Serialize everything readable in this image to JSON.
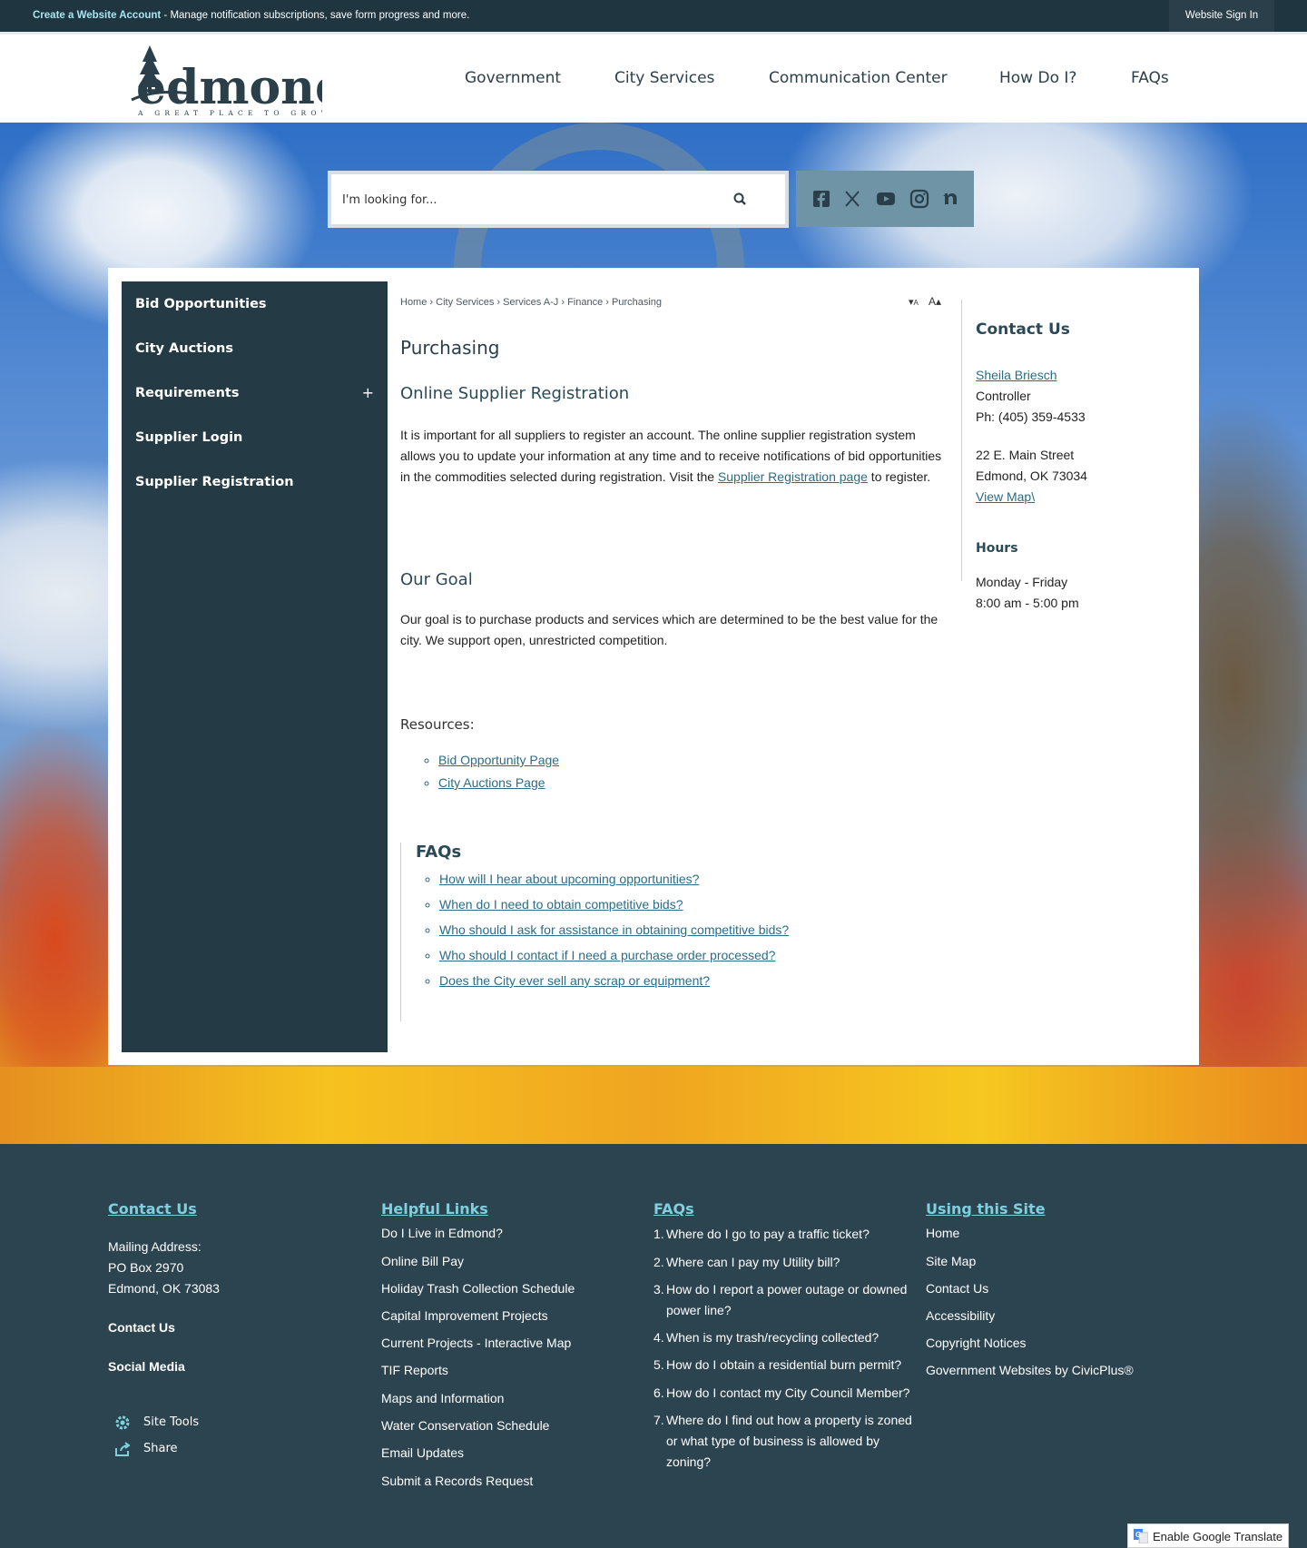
{
  "topbar": {
    "create_account_link": "Create a Website Account",
    "create_account_desc": " - Manage notification subscriptions, save form progress and more.",
    "sign_in": "Website Sign In"
  },
  "header": {
    "logo_text": "edmond",
    "logo_tagline": "A GREAT PLACE TO GROW",
    "nav": [
      "Government",
      "City Services",
      "Communication Center",
      "How Do I?",
      "FAQs"
    ]
  },
  "search": {
    "placeholder": "I'm looking for..."
  },
  "social": [
    "facebook-icon",
    "x-icon",
    "youtube-icon",
    "instagram-icon",
    "nextdoor-icon"
  ],
  "sidenav": {
    "items": [
      "Bid Opportunities",
      "City Auctions",
      "Requirements",
      "Supplier Login",
      "Supplier Registration"
    ],
    "expand_symbol": "+"
  },
  "breadcrumb": {
    "items": [
      "Home",
      "City Services",
      "Services A-J",
      "Finance",
      "Purchasing"
    ],
    "separator": "›"
  },
  "font_size": {
    "decrease": "A",
    "increase": "A"
  },
  "page": {
    "title": "Purchasing",
    "section1_title": "Online Supplier Registration",
    "section1_text_a": "It is important for all suppliers to register an account. The online supplier registration system allows you to update your information at any time and to receive notifications of bid opportunities in the commodities selected during registration. Visit the ",
    "section1_link": "Supplier Registration page",
    "section1_text_b": " to register.",
    "section2_title": "Our Goal",
    "section2_text": "Our goal is to purchase products and services which are determined to be the best value for the city. We support open, unrestricted competition.",
    "resources_label": "Resources:",
    "resources": [
      "Bid Opportunity Page",
      "City Auctions Page"
    ],
    "faqs_title": "FAQs",
    "faqs": [
      "How will I hear about upcoming opportunities?",
      "When do I need to obtain competitive bids?",
      "Who should I ask for assistance in obtaining competitive bids?",
      "Who should I contact if I need a purchase order processed?",
      "Does the City ever sell any scrap or equipment?"
    ]
  },
  "contact": {
    "title": "Contact Us",
    "name": "Sheila Briesch",
    "role": "Controller",
    "phone": "Ph: (405) 359-4533",
    "address1": "22 E. Main Street",
    "address2": "Edmond, OK 73034",
    "map_link": "View Map\\",
    "hours_title": "Hours",
    "hours_days": "Monday - Friday",
    "hours_time": "8:00 am - 5:00 pm"
  },
  "footer": {
    "contact": {
      "heading": "Contact Us",
      "mail_label": "Mailing Address:",
      "mail_line1": "PO Box 2970",
      "mail_line2": "Edmond, OK 73083",
      "contact_link": "Contact Us",
      "social_link": "Social Media",
      "site_tools": "Site Tools",
      "share": "Share"
    },
    "helpful": {
      "heading": "Helpful Links",
      "links": [
        "Do I Live in Edmond?",
        "Online Bill Pay",
        "Holiday Trash Collection Schedule",
        "Capital Improvement Projects",
        "Current Projects - Interactive Map",
        "TIF Reports",
        "Maps and Information",
        "Water Conservation Schedule",
        "Email Updates",
        "Submit a Records Request"
      ]
    },
    "faqs": {
      "heading": "FAQs",
      "items": [
        "Where do I go to pay a traffic ticket?",
        "Where can I pay my Utility bill?",
        "How do I report a power outage or downed power line?",
        "When is my trash/recycling collected?",
        "How do I obtain a residential burn permit?",
        "How do I contact my City Council Member?",
        "Where do I find out how a property is zoned or what type of business is allowed by zoning?"
      ]
    },
    "using": {
      "heading": "Using this Site",
      "links": [
        "Home",
        "Site Map",
        "Contact Us",
        "Accessibility",
        "Copyright Notices",
        "Government Websites by CivicPlus®"
      ]
    },
    "translate": "Enable Google Translate"
  },
  "colors": {
    "topbar": "#1f3540",
    "sidenav": "#243a45",
    "footer": "#2c4350",
    "link": "#2c6c86",
    "footer_heading": "#7fd0de",
    "social_bar": "#6f94a6"
  }
}
